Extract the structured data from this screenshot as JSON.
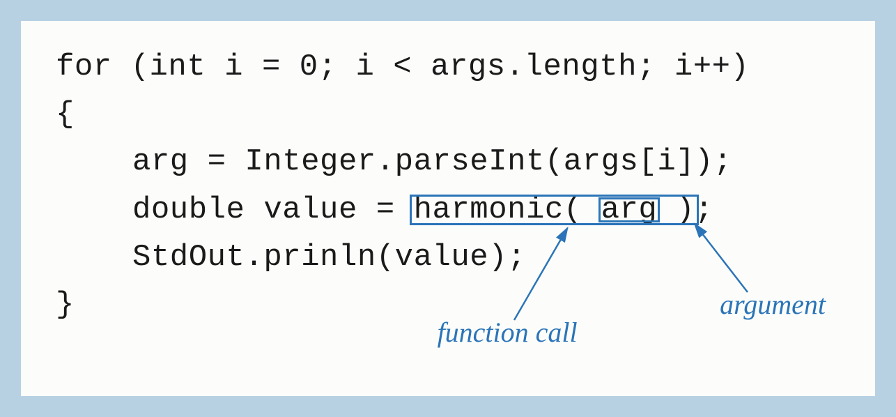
{
  "code": {
    "line1": "for (int i = 0; i < args.length; i++)",
    "line2": "{",
    "line3": "arg = Integer.parseInt(args[i]);",
    "line4_prefix": "double value = ",
    "line4_call_fn": "harmonic(",
    "line4_call_arg": "arg",
    "line4_call_close": ")",
    "line4_semicolon": ";",
    "line5": "StdOut.prinln(value);",
    "line6": "}"
  },
  "annotations": {
    "function_call": "function call",
    "argument": "argument"
  }
}
